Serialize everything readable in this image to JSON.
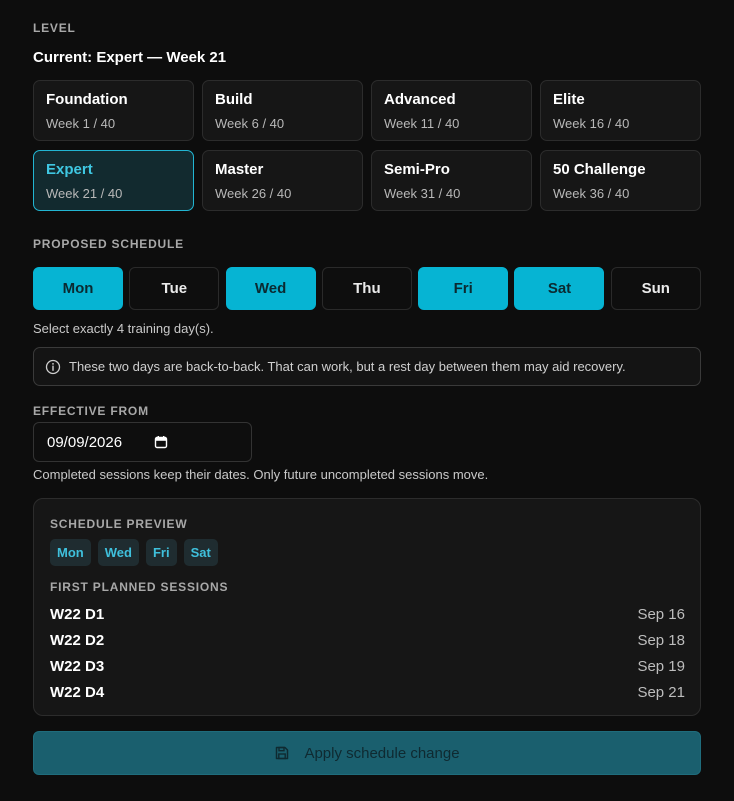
{
  "level": {
    "section_label": "LEVEL",
    "current": "Current: Expert — Week 21",
    "cards": [
      {
        "name": "Foundation",
        "week": "Week 1 / 40",
        "active": false
      },
      {
        "name": "Build",
        "week": "Week 6 / 40",
        "active": false
      },
      {
        "name": "Advanced",
        "week": "Week 11 / 40",
        "active": false
      },
      {
        "name": "Elite",
        "week": "Week 16 / 40",
        "active": false
      },
      {
        "name": "Expert",
        "week": "Week 21 / 40",
        "active": true
      },
      {
        "name": "Master",
        "week": "Week 26 / 40",
        "active": false
      },
      {
        "name": "Semi-Pro",
        "week": "Week 31 / 40",
        "active": false
      },
      {
        "name": "50 Challenge",
        "week": "Week 36 / 40",
        "active": false
      }
    ]
  },
  "schedule": {
    "section_label": "PROPOSED SCHEDULE",
    "days": [
      {
        "label": "Mon",
        "selected": true
      },
      {
        "label": "Tue",
        "selected": false
      },
      {
        "label": "Wed",
        "selected": true
      },
      {
        "label": "Thu",
        "selected": false
      },
      {
        "label": "Fri",
        "selected": true
      },
      {
        "label": "Sat",
        "selected": true
      },
      {
        "label": "Sun",
        "selected": false
      }
    ],
    "hint": "Select exactly 4 training day(s).",
    "notice": {
      "icon": "info-icon",
      "text": "These two days are back-to-back. That can work, but a rest day between them may aid recovery."
    }
  },
  "effective": {
    "section_label": "EFFECTIVE FROM",
    "date_value": "09/09/2026",
    "icon": "calendar-icon",
    "note": "Completed sessions keep their dates. Only future uncompleted sessions move."
  },
  "preview": {
    "label": "SCHEDULE PREVIEW",
    "chips": [
      "Mon",
      "Wed",
      "Fri",
      "Sat"
    ],
    "sessions_label": "FIRST PLANNED SESSIONS",
    "sessions": [
      {
        "name": "W22 D1",
        "date": "Sep 16"
      },
      {
        "name": "W22 D2",
        "date": "Sep 18"
      },
      {
        "name": "W22 D3",
        "date": "Sep 19"
      },
      {
        "name": "W22 D4",
        "date": "Sep 21"
      }
    ]
  },
  "apply": {
    "label": "Apply schedule change",
    "icon": "save-icon"
  },
  "colors": {
    "background": "#0d0d0d",
    "accent": "#06b4d3",
    "active_card_border": "#22b5d2",
    "apply_button": "#1a5f6e"
  }
}
